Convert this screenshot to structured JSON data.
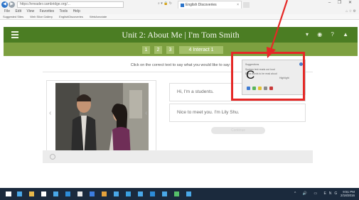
{
  "browser": {
    "address": "https://ereader.cambridge.org/...",
    "tab_title": "English Discoveries",
    "tab_close": "×",
    "window_controls": "– ❐ ✕",
    "menu": [
      "File",
      "Edit",
      "View",
      "Favorites",
      "Tools",
      "Help"
    ],
    "favorites": [
      "Suggested Sites",
      "Web Slice Gallery",
      "EnglishDiscoveries",
      "WebAnnotate"
    ],
    "addr_icons": "⌕ ▾ 🔒 ↻",
    "top_right_icons": "⌂ ☆ ⚙"
  },
  "app": {
    "title": "Unit 2: About Me | I'm Tom Smith",
    "header_icons": "▾ ◉ ? ▲",
    "steps": [
      "1",
      "2",
      "3"
    ],
    "active_step": "4  Interact 1"
  },
  "page": {
    "instruction": "Click on the correct text to say what you would like to say:",
    "options": [
      "Hi, I'm a students.",
      "Nice to meet you. I'm Lily Shu."
    ],
    "continue": "Continue",
    "arrow_left": "‹",
    "arrow_right": "‹"
  },
  "popup": {
    "lines": [
      "Suggestions",
      "Spoken text reads out loud",
      "Extra words to be read aloud",
      "Highlight"
    ],
    "tool_colors": [
      "#3f7bd2",
      "#5ab55a",
      "#e2c233",
      "#8b8b8b",
      "#c93a3a"
    ]
  },
  "annotation": {
    "letter": "C",
    "color": "#e52826"
  },
  "taskbar": {
    "time": "9:51 PM",
    "date": "2/18/2016",
    "tray": "^ 🔊 ▭ ENG",
    "icon_colors": [
      "#ffffff",
      "#4aa8e8",
      "#e8b84a",
      "#ffffff",
      "#4aa8e8",
      "#2d8cd8",
      "#e8e8e8",
      "#3c7de0",
      "#e4a23c",
      "#4aa8e8",
      "#3aa0e0",
      "#4aa8e8",
      "#2d8cd8",
      "#4aa8e8",
      "#56c06a",
      "#4aa8e8"
    ]
  }
}
